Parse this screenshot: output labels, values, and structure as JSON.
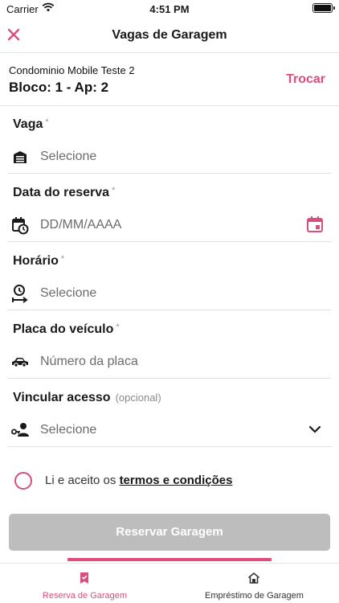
{
  "status": {
    "carrier": "Carrier",
    "time": "4:51 PM"
  },
  "header": {
    "title": "Vagas de Garagem",
    "close_icon": "close-icon"
  },
  "condo": {
    "name": "Condominio Mobile Teste 2",
    "unit": "Bloco: 1 - Ap: 2",
    "switch_label": "Trocar"
  },
  "form": {
    "vaga": {
      "label": "Vaga",
      "required": "*",
      "value": "Selecione",
      "icon": "garage-icon"
    },
    "data": {
      "label": "Data do reserva",
      "required": "*",
      "placeholder": "DD/MM/AAAA",
      "icon": "calendar-clock-icon",
      "action_icon": "calendar-icon"
    },
    "horario": {
      "label": "Horário",
      "required": "*",
      "value": "Selecione",
      "icon": "time-range-icon"
    },
    "placa": {
      "label": "Placa do veículo",
      "required": "*",
      "placeholder": "Número da placa",
      "icon": "car-icon"
    },
    "acesso": {
      "label": "Vincular acesso",
      "optional": "(opcional)",
      "value": "Selecione",
      "icon": "key-person-icon",
      "action_icon": "chevron-down-icon"
    }
  },
  "terms": {
    "prefix": "Li e aceito os",
    "link": "termos e condições",
    "checked": false
  },
  "submit_label": "Reservar Garagem",
  "tabs": [
    {
      "label": "Reserva de Garagem",
      "icon": "bookmark-icon",
      "active": true
    },
    {
      "label": "Empréstimo de Garagem",
      "icon": "home-icon",
      "active": false
    }
  ],
  "colors": {
    "accent": "#d94e7a",
    "disabled_button": "#bdbdbd"
  }
}
